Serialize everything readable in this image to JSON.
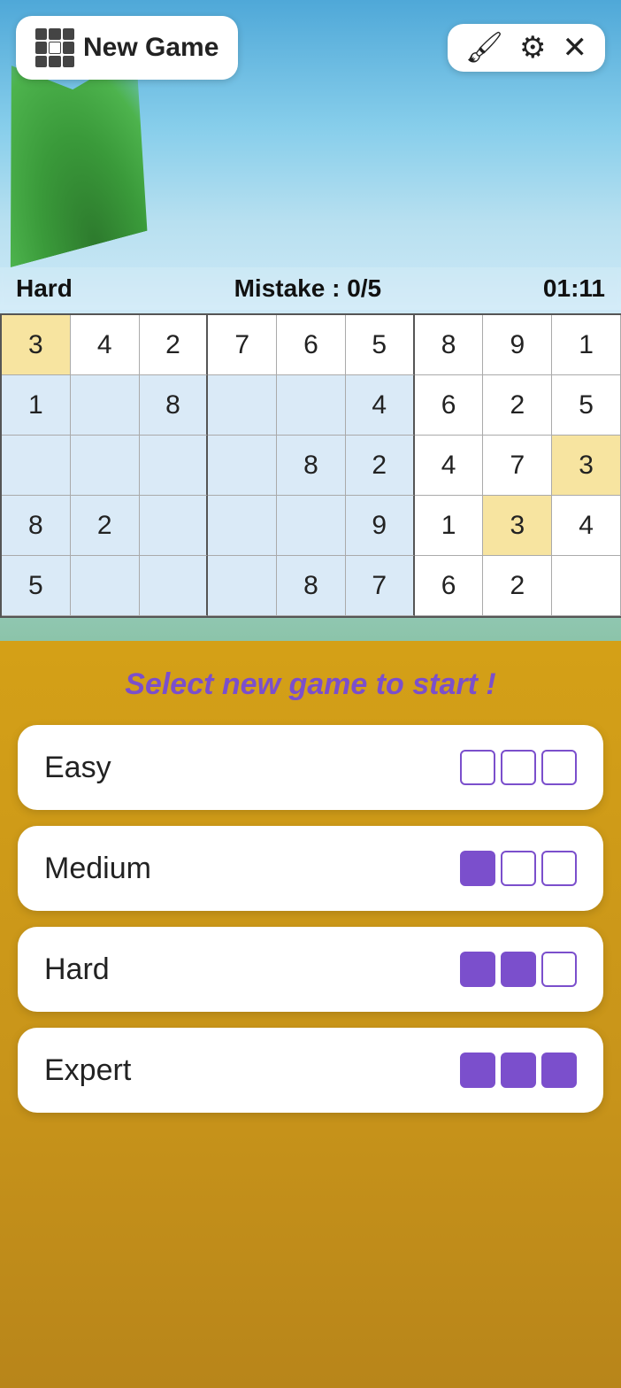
{
  "header": {
    "new_game_label": "New Game",
    "paint_icon": "🖌",
    "settings_icon": "⚙",
    "close_icon": "✕"
  },
  "status": {
    "difficulty": "Hard",
    "mistake_label": "Mistake : 0/5",
    "timer": "01:11"
  },
  "grid": {
    "rows": [
      [
        "3",
        "4",
        "2",
        "7",
        "6",
        "5",
        "8",
        "9",
        "1"
      ],
      [
        "1",
        "",
        "8",
        "",
        "",
        "4",
        "6",
        "2",
        "5"
      ],
      [
        "",
        "",
        "",
        "",
        "8",
        "2",
        "4",
        "7",
        "3"
      ],
      [
        "8",
        "2",
        "",
        "",
        "",
        "9",
        "1",
        "3",
        "4"
      ],
      [
        "5",
        "",
        "",
        "",
        "8",
        "7",
        "6",
        "2",
        ""
      ]
    ]
  },
  "overlay": {
    "prompt": "Select new game to start !",
    "difficulties": [
      {
        "label": "Easy",
        "filled": 0,
        "total": 3
      },
      {
        "label": "Medium",
        "filled": 1,
        "total": 3
      },
      {
        "label": "Hard",
        "filled": 2,
        "total": 3
      },
      {
        "label": "Expert",
        "filled": 3,
        "total": 3
      }
    ]
  }
}
